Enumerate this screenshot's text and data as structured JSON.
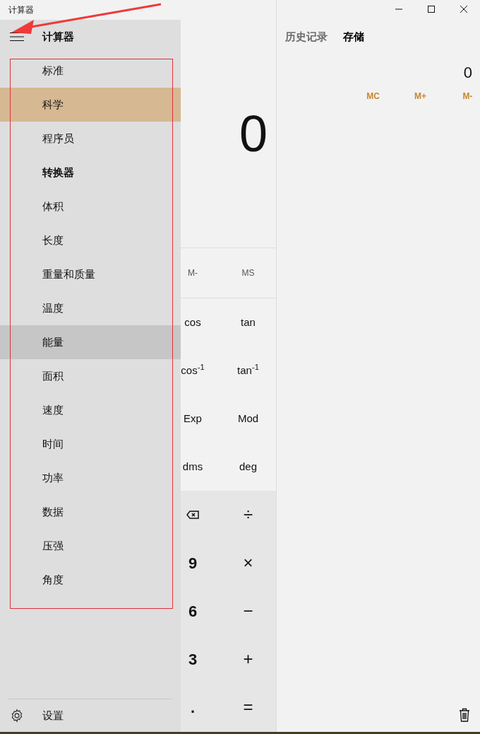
{
  "title_bar": {
    "title": "计算器"
  },
  "nav_drawer": {
    "title": "计算器",
    "items": [
      {
        "label": "标准",
        "kind": "item",
        "selected": false,
        "hovered": false
      },
      {
        "label": "科学",
        "kind": "item",
        "selected": true,
        "hovered": false
      },
      {
        "label": "程序员",
        "kind": "item",
        "selected": false,
        "hovered": false
      },
      {
        "label": "转换器",
        "kind": "header",
        "selected": false,
        "hovered": false
      },
      {
        "label": "体积",
        "kind": "item",
        "selected": false,
        "hovered": false
      },
      {
        "label": "长度",
        "kind": "item",
        "selected": false,
        "hovered": false
      },
      {
        "label": "重量和质量",
        "kind": "item",
        "selected": false,
        "hovered": false
      },
      {
        "label": "温度",
        "kind": "item",
        "selected": false,
        "hovered": false
      },
      {
        "label": "能量",
        "kind": "item",
        "selected": false,
        "hovered": true
      },
      {
        "label": "面积",
        "kind": "item",
        "selected": false,
        "hovered": false
      },
      {
        "label": "速度",
        "kind": "item",
        "selected": false,
        "hovered": false
      },
      {
        "label": "时间",
        "kind": "item",
        "selected": false,
        "hovered": false
      },
      {
        "label": "功率",
        "kind": "item",
        "selected": false,
        "hovered": false
      },
      {
        "label": "数据",
        "kind": "item",
        "selected": false,
        "hovered": false
      },
      {
        "label": "压强",
        "kind": "item",
        "selected": false,
        "hovered": false
      },
      {
        "label": "角度",
        "kind": "item",
        "selected": false,
        "hovered": false
      }
    ],
    "settings": "设置"
  },
  "calculator": {
    "display": "0",
    "memory_keys": [
      "M-",
      "MS"
    ],
    "function_keys": [
      [
        "cos",
        "tan"
      ],
      [
        "cos$^{-1}$",
        "tan$^{-1}$"
      ],
      [
        "Exp",
        "Mod"
      ],
      [
        "dms",
        "deg"
      ]
    ],
    "keypad": [
      [
        {
          "kind": "backspace"
        },
        {
          "kind": "operator",
          "label": "÷"
        }
      ],
      [
        {
          "kind": "digit",
          "label": "9"
        },
        {
          "kind": "operator",
          "label": "×"
        }
      ],
      [
        {
          "kind": "digit",
          "label": "6"
        },
        {
          "kind": "operator",
          "label": "−"
        }
      ],
      [
        {
          "kind": "digit",
          "label": "3"
        },
        {
          "kind": "operator",
          "label": "+"
        }
      ],
      [
        {
          "kind": "digit",
          "label": "."
        },
        {
          "kind": "operator",
          "label": "="
        }
      ]
    ]
  },
  "side_panel": {
    "tabs": [
      {
        "label": "历史记录",
        "selected": false
      },
      {
        "label": "存储",
        "selected": true
      }
    ],
    "memory_value": "0",
    "memory_actions": [
      "MC",
      "M+",
      "M-"
    ]
  }
}
